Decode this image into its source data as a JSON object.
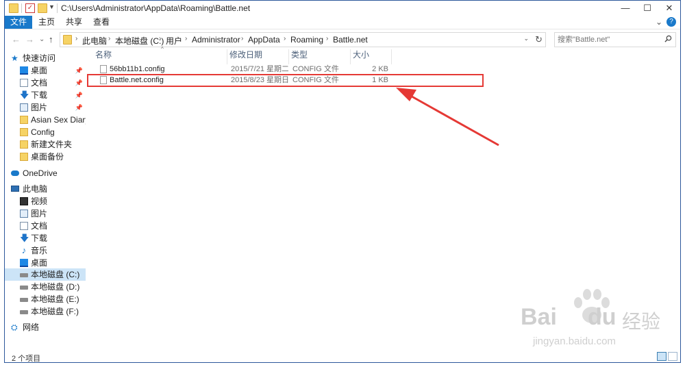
{
  "window": {
    "title_path": "C:\\Users\\Administrator\\AppData\\Roaming\\Battle.net",
    "min_glyph": "—",
    "max_glyph": "☐",
    "close_glyph": "✕"
  },
  "ribbon": {
    "tabs": [
      {
        "label": "文件",
        "active": true
      },
      {
        "label": "主页",
        "active": false
      },
      {
        "label": "共享",
        "active": false
      },
      {
        "label": "查看",
        "active": false
      }
    ],
    "expand_glyph": "⌄",
    "help_glyph": "?"
  },
  "address": {
    "back_glyph": "←",
    "forward_glyph": "→",
    "recent_glyph": "⌄",
    "up_glyph": "↑",
    "crumbs": [
      "此电脑",
      "本地磁盘 (C:)",
      "用户",
      "Administrator",
      "AppData",
      "Roaming",
      "Battle.net"
    ],
    "crumb_sep": "›",
    "dropdown_glyph": "⌄",
    "refresh_glyph": "↻"
  },
  "search": {
    "placeholder": "搜索\"Battle.net\""
  },
  "nav": {
    "quick_access": "快速访问",
    "pinned": [
      "桌面",
      "文档",
      "下载",
      "图片"
    ],
    "folders": [
      "Asian Sex Diary 中国",
      "Config",
      "新建文件夹",
      "桌面备份"
    ],
    "onedrive": "OneDrive",
    "this_pc": "此电脑",
    "pc_items": [
      "视频",
      "图片",
      "文档",
      "下载",
      "音乐",
      "桌面"
    ],
    "drives": [
      "本地磁盘 (C:)",
      "本地磁盘 (D:)",
      "本地磁盘 (E:)",
      "本地磁盘 (F:)"
    ],
    "network": "网络",
    "pin_glyph": "📌"
  },
  "columns": {
    "name": "名称",
    "modified": "修改日期",
    "type": "类型",
    "size": "大小",
    "sort_glyph": "^"
  },
  "files": [
    {
      "name": "56bb11b1.config",
      "modified": "2015/7/21 星期二 ...",
      "type": "CONFIG 文件",
      "size": "2 KB"
    },
    {
      "name": "Battle.net.config",
      "modified": "2015/8/23 星期日 ...",
      "type": "CONFIG 文件",
      "size": "1 KB"
    }
  ],
  "status": {
    "item_count": "2 个项目"
  },
  "annotation": {
    "color": "#e53935"
  },
  "watermark": {
    "brand": "Bai",
    "brand_end": "du",
    "chinese": "经验",
    "url": "jingyan.baidu.com"
  }
}
